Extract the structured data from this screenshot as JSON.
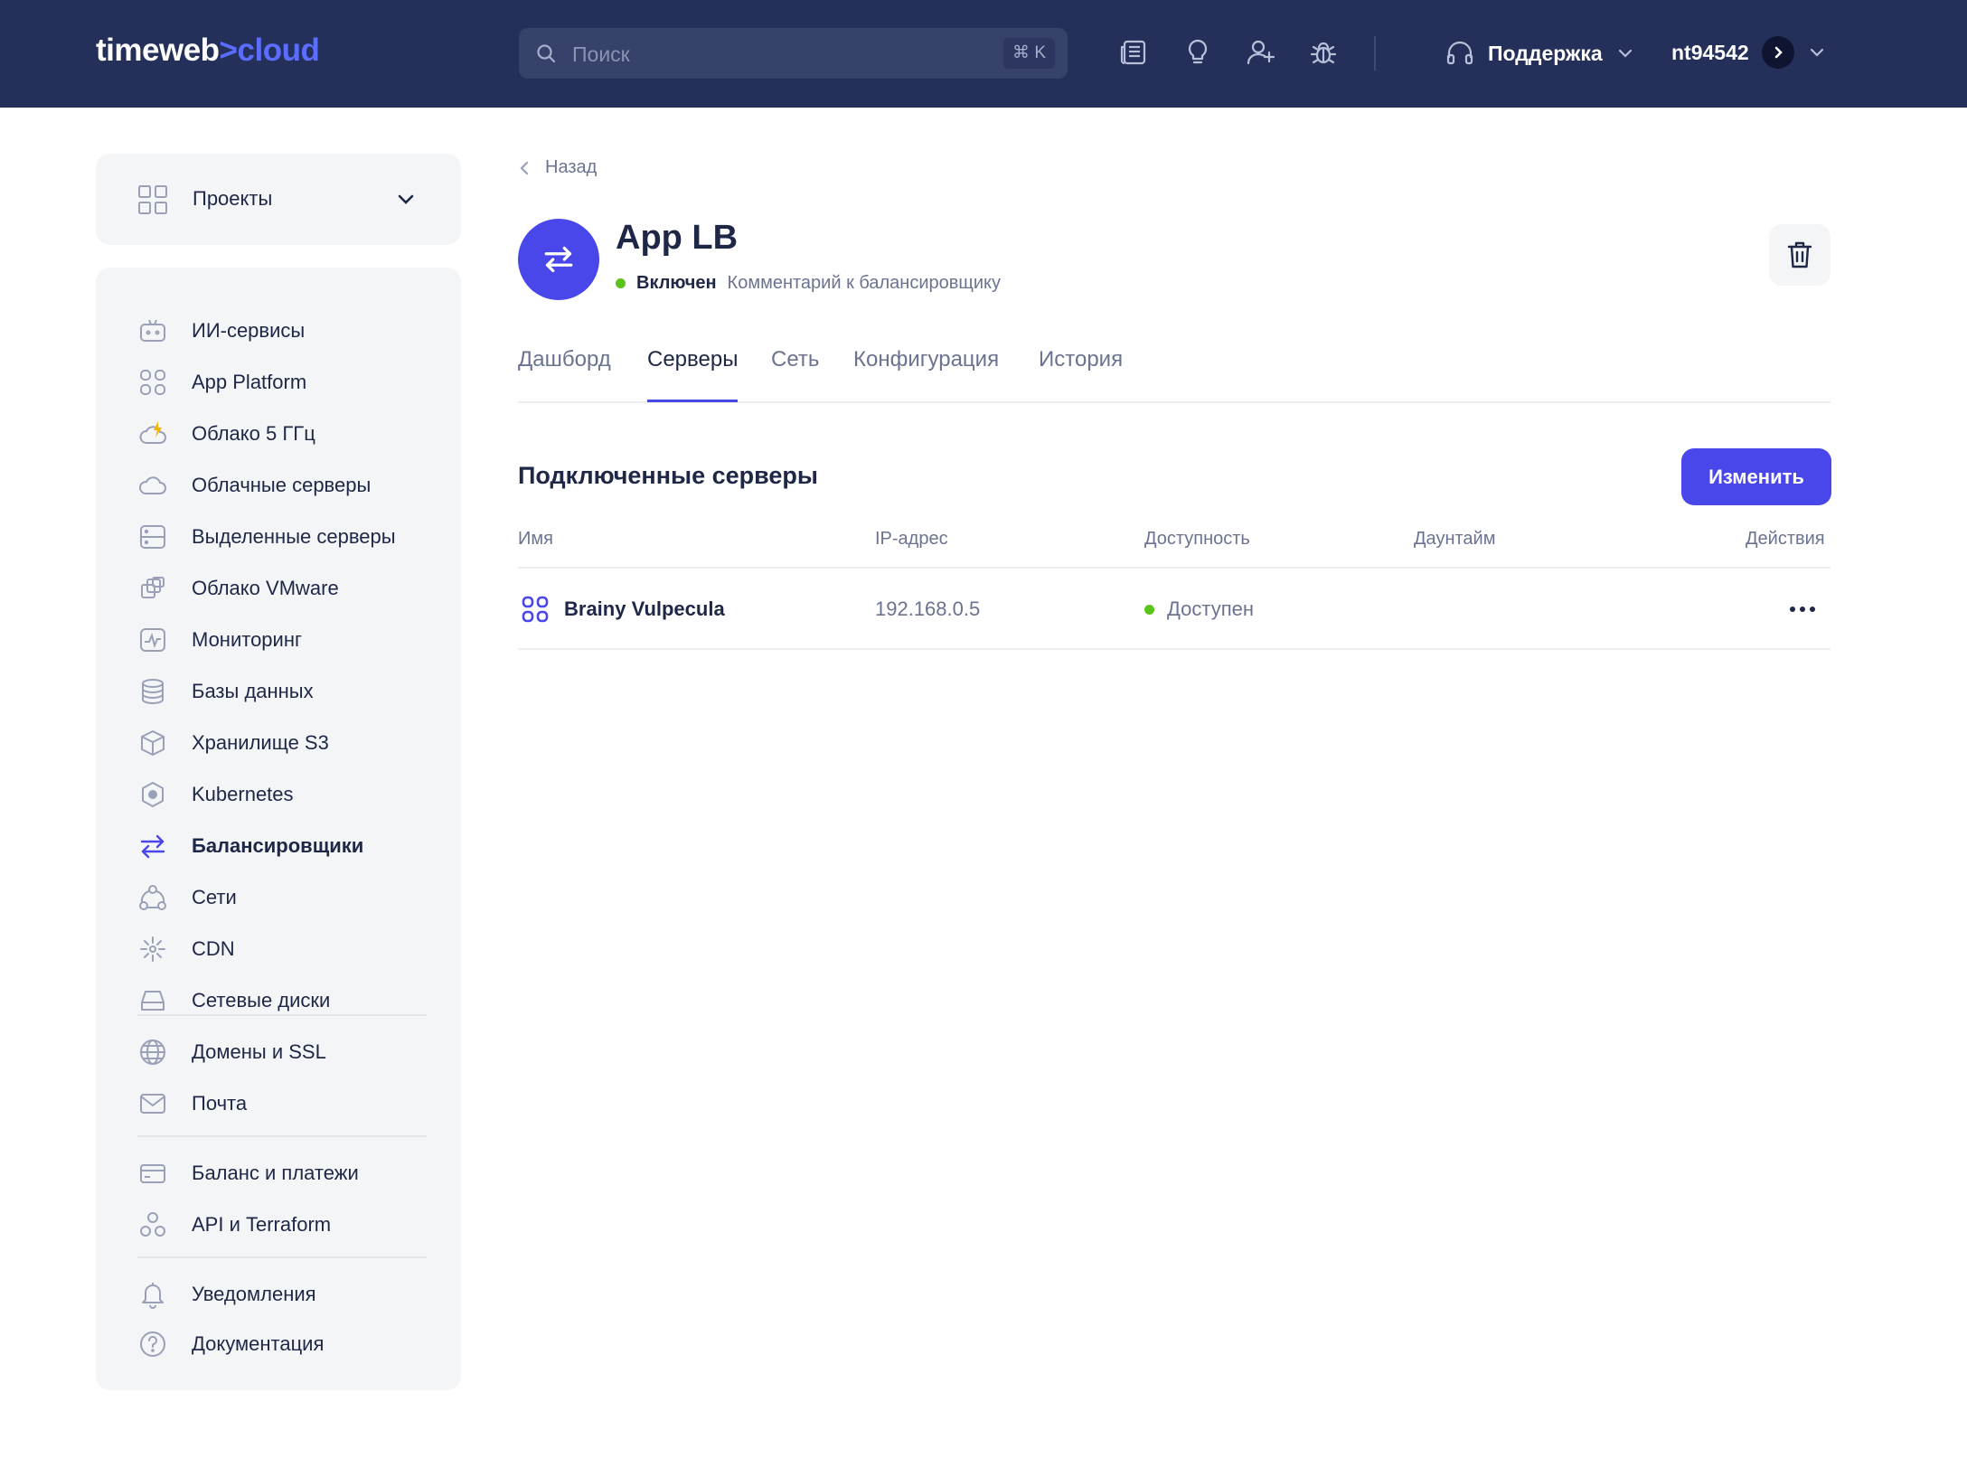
{
  "header": {
    "logo_main": "timeweb",
    "logo_arrow": ">",
    "logo_accent": "cloud",
    "search_placeholder": "Поиск",
    "search_shortcut": "⌘ K",
    "icons": [
      "news-icon",
      "lightbulb-icon",
      "add-user-icon",
      "bug-icon"
    ],
    "support_label": "Поддержка",
    "username": "nt94542"
  },
  "sidebar": {
    "projects_label": "Проекты",
    "items": [
      {
        "label": "ИИ-сервисы",
        "icon": "robot-icon"
      },
      {
        "label": "App Platform",
        "icon": "apps-grid-icon"
      },
      {
        "label": "Облако 5 ГГц",
        "icon": "cloud-bolt-icon"
      },
      {
        "label": "Облачные серверы",
        "icon": "cloud-icon"
      },
      {
        "label": "Выделенные серверы",
        "icon": "server-icon"
      },
      {
        "label": "Облако VMware",
        "icon": "vmware-icon"
      },
      {
        "label": "Мониторинг",
        "icon": "monitoring-icon"
      },
      {
        "label": "Базы данных",
        "icon": "database-icon"
      },
      {
        "label": "Хранилище S3",
        "icon": "cube-icon"
      },
      {
        "label": "Kubernetes",
        "icon": "kubernetes-icon"
      },
      {
        "label": "Балансировщики",
        "icon": "balancer-icon",
        "active": true
      },
      {
        "label": "Сети",
        "icon": "network-icon"
      },
      {
        "label": "CDN",
        "icon": "cdn-icon"
      },
      {
        "label": "Сетевые диски",
        "icon": "disk-icon"
      },
      {
        "label": "Домены и SSL",
        "icon": "globe-icon"
      },
      {
        "label": "Почта",
        "icon": "mail-icon"
      },
      {
        "label": "Баланс и платежи",
        "icon": "card-icon"
      },
      {
        "label": "API и Terraform",
        "icon": "api-icon"
      },
      {
        "label": "Уведомления",
        "icon": "bell-icon"
      },
      {
        "label": "Документация",
        "icon": "help-icon"
      }
    ]
  },
  "page": {
    "back_label": "Назад",
    "title": "App LB",
    "status": "Включен",
    "comment": "Комментарий к балансировщику",
    "tabs": [
      "Дашборд",
      "Серверы",
      "Сеть",
      "Конфигурация",
      "История"
    ],
    "active_tab": "Серверы"
  },
  "servers": {
    "section_title": "Подключенные серверы",
    "edit_button": "Изменить",
    "columns": [
      "Имя",
      "IP-адрес",
      "Доступность",
      "Даунтайм",
      "Действия"
    ],
    "rows": [
      {
        "name": "Brainy Vulpecula",
        "ip": "192.168.0.5",
        "availability": "Доступен",
        "downtime": ""
      }
    ]
  },
  "colors": {
    "header_bg": "#24305a",
    "accent": "#4a47ea",
    "status_green": "#5ac41b",
    "sidebar_bg": "#f4f5f7"
  }
}
